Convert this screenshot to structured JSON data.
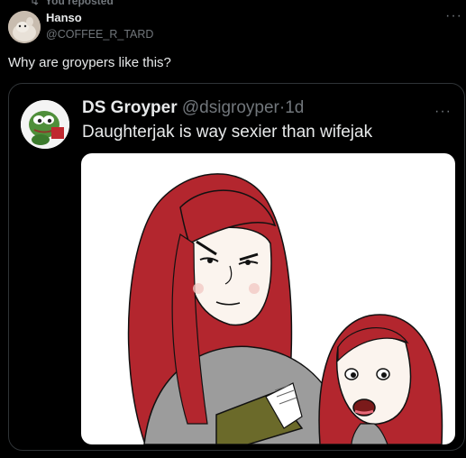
{
  "repost": {
    "label": "You reposted"
  },
  "author": {
    "name": "Hanso",
    "handle": "@COFFEE_R_TARD"
  },
  "post": {
    "text": "Why are groypers like this?"
  },
  "quote": {
    "name": "DS Groyper",
    "handle": "@dsigroyper",
    "separator": "·",
    "time": "1d",
    "text": "Daughterjak is way sexier than wifejak"
  },
  "icons": [
    "repost-icon",
    "more-icon",
    "avatar",
    "pepe-avatar"
  ],
  "colors": {
    "text": "#e7e9ea",
    "muted": "#71767b",
    "border": "#2f3336",
    "hair": "#b3262e"
  }
}
